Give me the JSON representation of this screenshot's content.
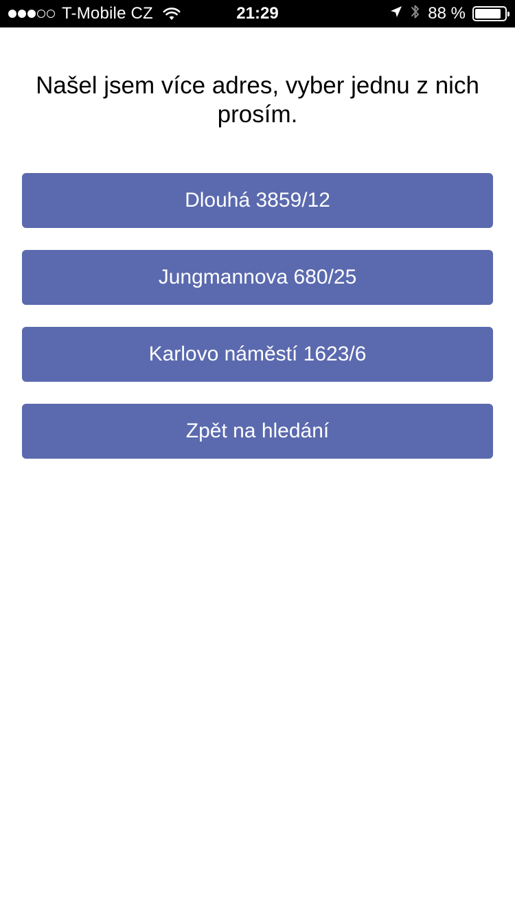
{
  "status_bar": {
    "signal_dots": [
      true,
      true,
      true,
      false,
      false
    ],
    "carrier": "T-Mobile CZ",
    "time": "21:29",
    "battery_percent_text": "88 %",
    "battery_level": 0.88,
    "icons": [
      "wifi-icon",
      "location-arrow-icon",
      "bluetooth-icon",
      "battery-icon"
    ]
  },
  "prompt": {
    "text": "Našel jsem více adres, vyber jednu z nich prosím."
  },
  "options": [
    {
      "label": "Dlouhá 3859/12"
    },
    {
      "label": "Jungmannova 680/25"
    },
    {
      "label": "Karlovo náměstí 1623/6"
    }
  ],
  "back_button": {
    "label": "Zpět na hledání"
  },
  "colors": {
    "button_bg": "#5b6aae",
    "button_text": "#ffffff",
    "status_bar_bg": "#000000",
    "page_bg": "#ffffff"
  }
}
